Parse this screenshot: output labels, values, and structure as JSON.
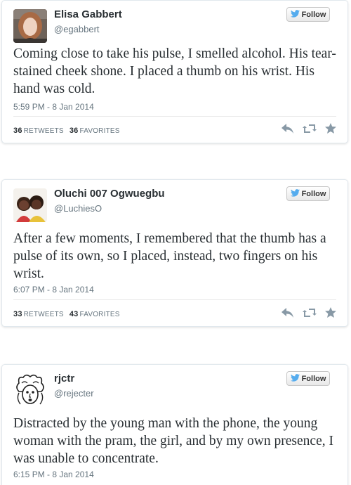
{
  "tweets": [
    {
      "name": "Elisa Gabbert",
      "handle": "@egabbert",
      "follow_label": "Follow",
      "text": "Coming close to take his pulse, I smelled alcohol. His tear-stained cheek shone. I placed a thumb on his wrist. His hand was cold.",
      "time": "5:59 PM - 8 Jan 2014",
      "retweets": "36",
      "retweets_label": "RETWEETS",
      "favorites": "36",
      "favorites_label": "FAVORITES"
    },
    {
      "name": "Oluchi 007 Ogwuegbu",
      "handle": "@LuchiesO",
      "follow_label": "Follow",
      "text": "After a few moments, I remembered that the thumb has a pulse of its own, so I placed, instead, two fingers on his wrist.",
      "time": "6:07 PM - 8 Jan 2014",
      "retweets": "33",
      "retweets_label": "RETWEETS",
      "favorites": "43",
      "favorites_label": "FAVORITES"
    },
    {
      "name": "rjctr",
      "handle": "@rejecter",
      "follow_label": "Follow",
      "text": "Distracted by the young man with the phone, the young woman with the pram, the girl, and by my own presence, I was unable to concentrate.",
      "time": "6:15 PM - 8 Jan 2014"
    }
  ],
  "colors": {
    "bird": "#55acee",
    "action_icon": "#8899a6"
  },
  "icons": {
    "follow": "twitter-bird-icon",
    "reply": "reply-icon",
    "retweet": "retweet-icon",
    "favorite": "star-icon"
  }
}
